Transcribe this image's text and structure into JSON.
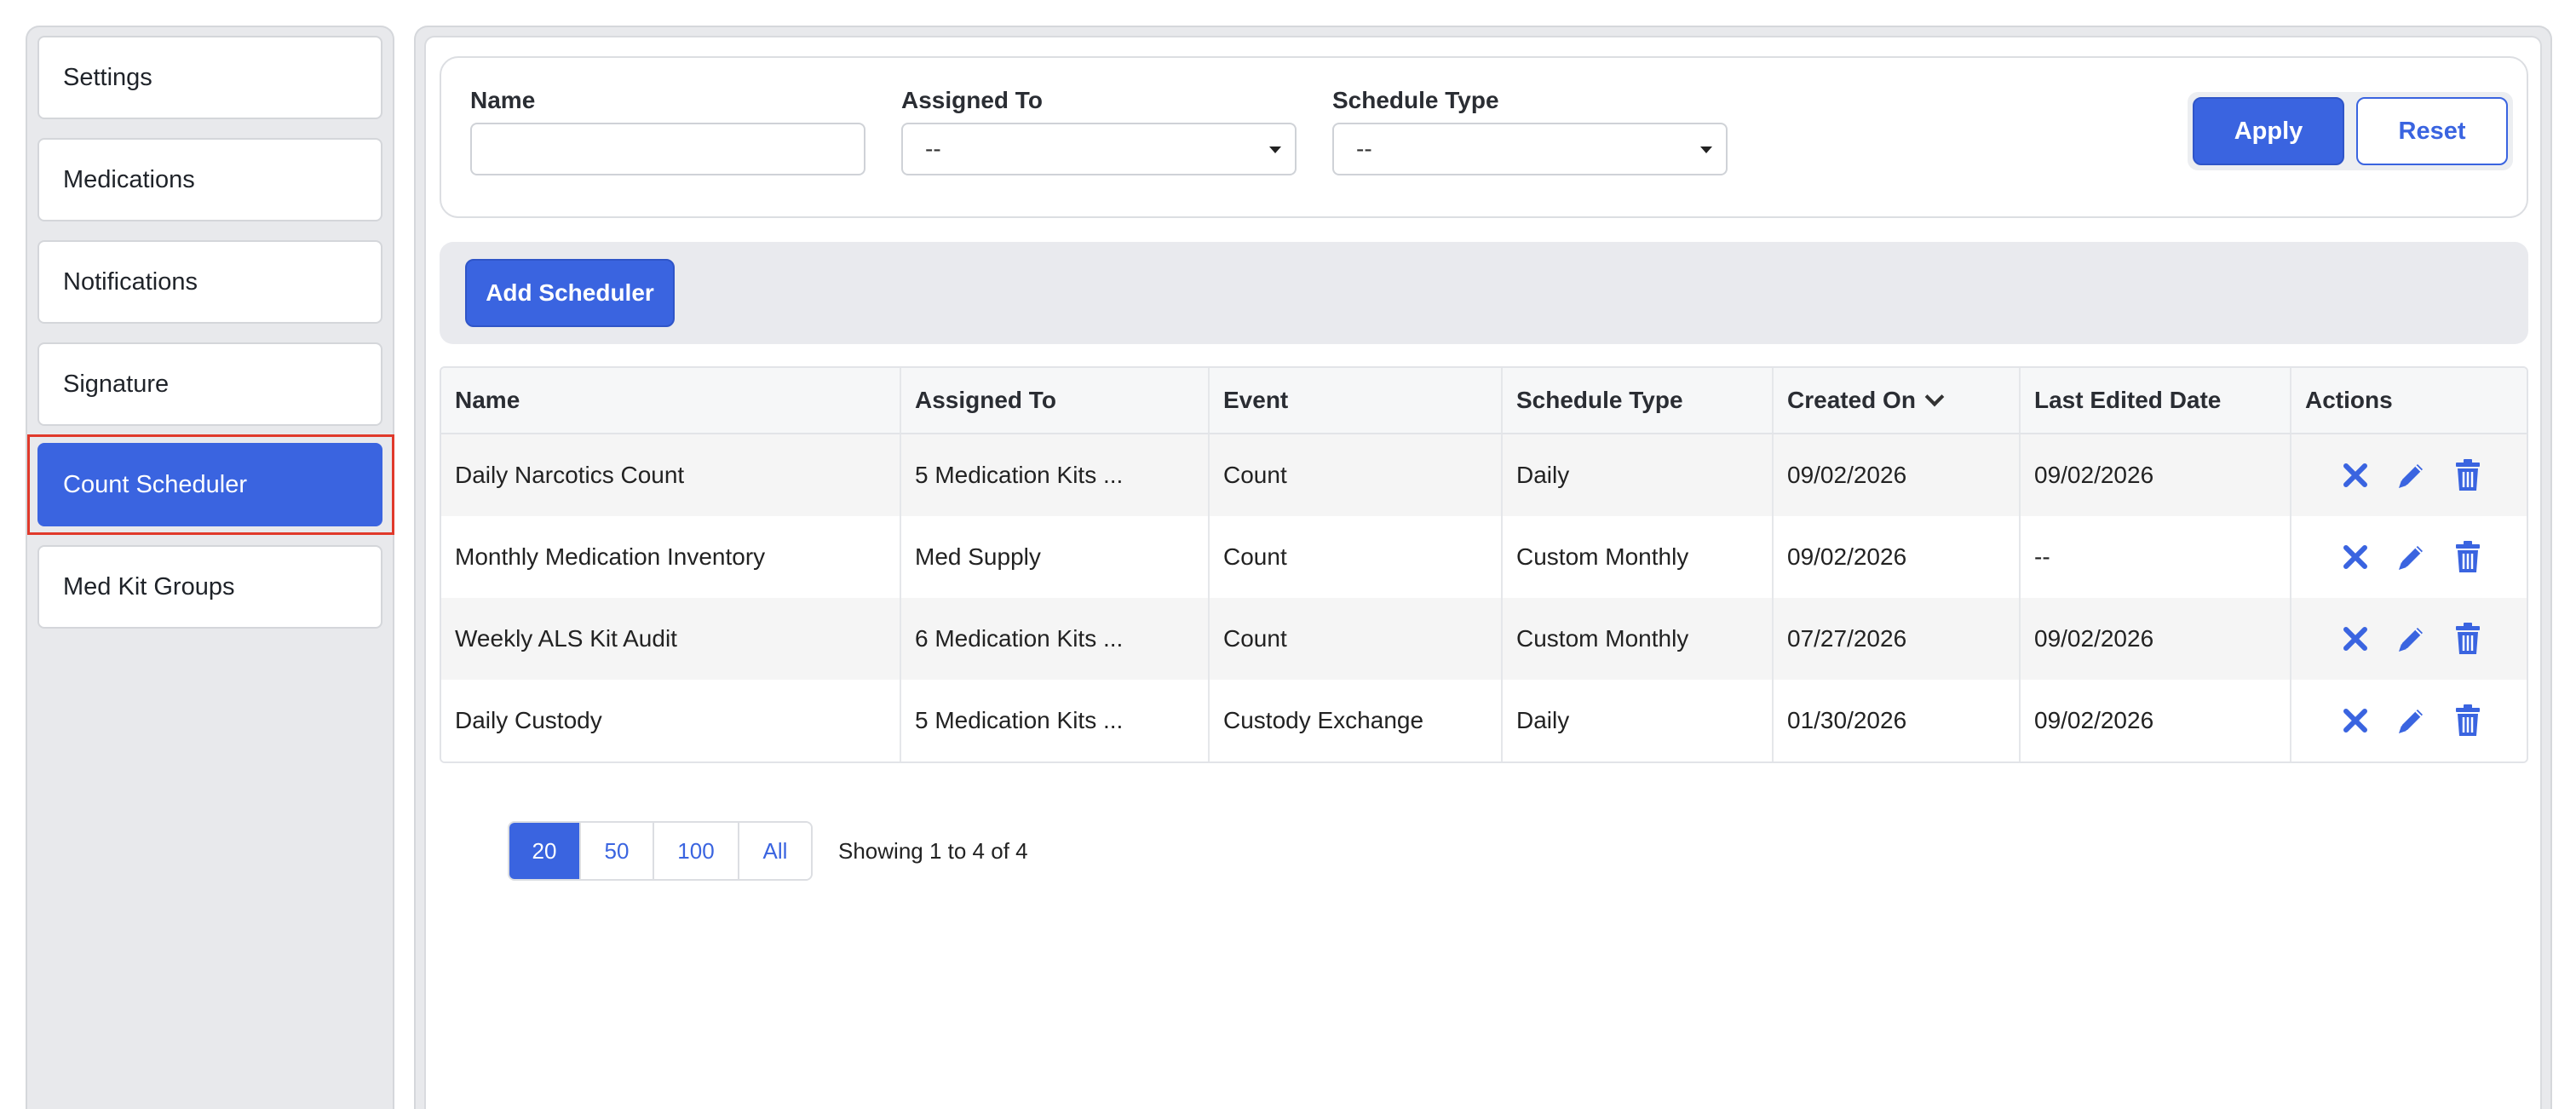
{
  "sidebar": {
    "items": [
      {
        "label": "Settings"
      },
      {
        "label": "Medications"
      },
      {
        "label": "Notifications"
      },
      {
        "label": "Signature"
      },
      {
        "label": "Count Scheduler"
      },
      {
        "label": "Med Kit Groups"
      }
    ],
    "active": "Count Scheduler"
  },
  "filters": {
    "name_label": "Name",
    "name_value": "",
    "assigned_label": "Assigned To",
    "assigned_value": "--",
    "schedule_label": "Schedule Type",
    "schedule_value": "--",
    "apply_label": "Apply",
    "reset_label": "Reset"
  },
  "toolbar": {
    "add_label": "Add Scheduler"
  },
  "table": {
    "headers": [
      "Name",
      "Assigned To",
      "Event",
      "Schedule Type",
      "Created On",
      "Last Edited Date",
      "Actions"
    ],
    "sort_column": "Created On",
    "sort_icon": "chevron-down-icon",
    "rows": [
      {
        "name": "Daily Narcotics Count",
        "assigned": "5 Medication Kits ...",
        "event": "Count",
        "schedule": "Daily",
        "created": "09/02/2026",
        "edited": "09/02/2026"
      },
      {
        "name": "Monthly Medication Inventory",
        "assigned": "Med Supply",
        "event": "Count",
        "schedule": "Custom Monthly",
        "created": "09/02/2026",
        "edited": "--"
      },
      {
        "name": "Weekly ALS Kit Audit",
        "assigned": "6 Medication Kits ...",
        "event": "Count",
        "schedule": "Custom Monthly",
        "created": "07/27/2026",
        "edited": "09/02/2026"
      },
      {
        "name": "Daily Custody",
        "assigned": "5 Medication Kits ...",
        "event": "Custody Exchange",
        "schedule": "Daily",
        "created": "01/30/2026",
        "edited": "09/02/2026"
      }
    ],
    "action_icons": [
      "close-icon",
      "pencil-icon",
      "trash-icon"
    ]
  },
  "pagination": {
    "sizes": [
      "20",
      "50",
      "100",
      "All"
    ],
    "active_size": "20",
    "showing": "Showing 1 to 4 of 4"
  },
  "colors": {
    "accent": "#3a64e0",
    "highlight": "#e0392b"
  }
}
